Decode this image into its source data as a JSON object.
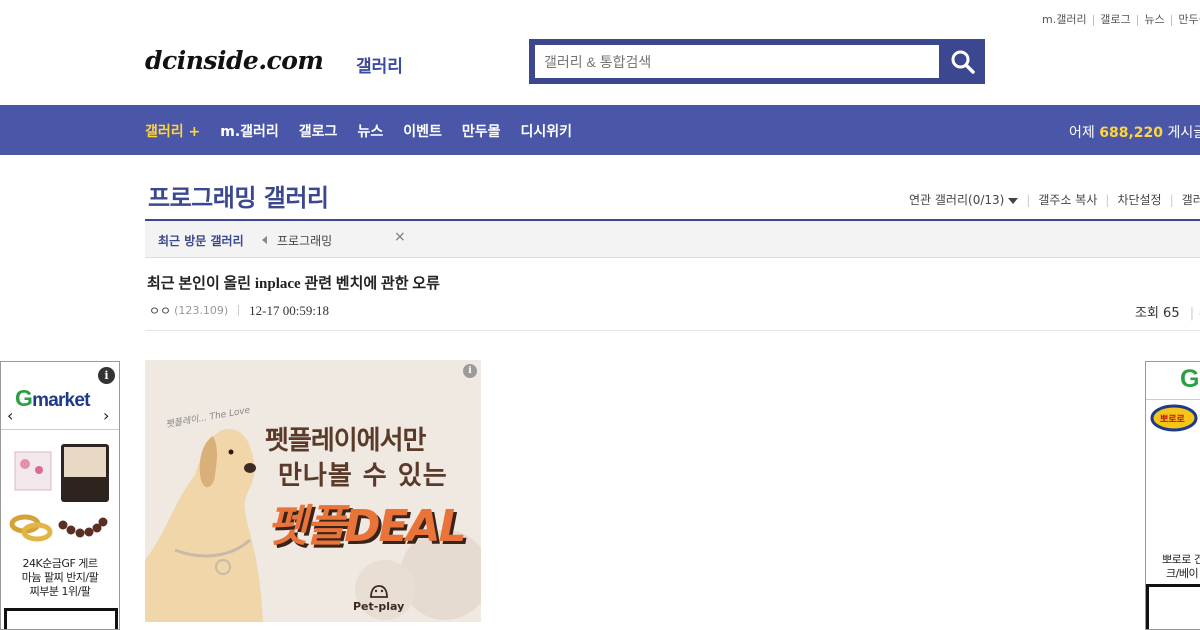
{
  "header": {
    "top_links": [
      "m.갤러리",
      "갤로그",
      "뉴스",
      "만두몰"
    ],
    "logo": "dcinside.com",
    "logo_sub": "갤러리",
    "search": {
      "placeholder": "갤러리 & 통합검색"
    }
  },
  "nav": {
    "items": [
      "갤러리 +",
      "m.갤러리",
      "갤로그",
      "뉴스",
      "이벤트",
      "만두몰",
      "디시위키"
    ],
    "count_prefix": "어제",
    "count_value": "688,220",
    "count_suffix": "게시글"
  },
  "gallery": {
    "title": "프로그래밍 갤러리",
    "links": [
      "연관 갤러리(0/13)",
      "갤주소 복사",
      "차단설정",
      "갤러"
    ]
  },
  "recent": {
    "label": "최근 방문 갤러리",
    "item": "프로그래밍",
    "close": "×"
  },
  "post": {
    "title": "최근 본인이 올린 inplace 관련 벤치에 관한 오류",
    "author": "ㅇㅇ",
    "ip": "(123.109)",
    "date": "12-17 00:59:18",
    "views": "조회 65",
    "views_tail": "|  추"
  },
  "ads": {
    "left": {
      "logo": "market",
      "logo_g": "G",
      "info": "i",
      "product_text": [
        "24K순금GF 게르",
        "마늄 팔찌 반지/팔",
        "찌부분 1위/팔"
      ]
    },
    "center": {
      "info": "i",
      "signature": "펫플레이... The Love",
      "line1": "펫플레이에서만",
      "line2": "만나볼 수 있는",
      "deal": "펫플DEAL",
      "brand": "Pet-play"
    },
    "right": {
      "logo_g": "G",
      "text1": "뽀로로 건",
      "text2": "크/베이",
      "badge": "뽀로로"
    }
  },
  "colors": {
    "nav_bg": "#4a56a8",
    "accent": "#3b4890",
    "highlight": "#ffd53c"
  }
}
